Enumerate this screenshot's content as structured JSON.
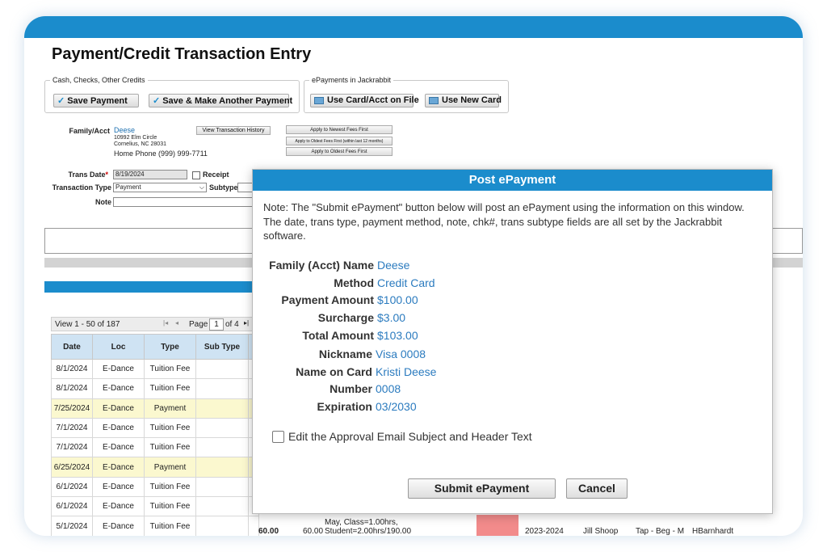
{
  "page_title": "Payment/Credit Transaction Entry",
  "groups": {
    "cash_legend": "Cash, Checks, Other Credits",
    "epay_legend": "ePayments in Jackrabbit",
    "save_payment": "Save Payment",
    "save_another": "Save & Make Another Payment",
    "use_card_on_file": "Use Card/Acct on File",
    "use_new_card": "Use New Card"
  },
  "family": {
    "label": "Family/Acct",
    "name": "Deese",
    "address1": "10992 Elm Circle",
    "address2": "Cornelius, NC 28031",
    "phone": "Home Phone (999) 999-7711",
    "view_history": "View Transaction History",
    "apply_newest": "Apply to Newest Fees First",
    "apply_oldest_12": "Apply to Oldest Fees First (within last 12 months)",
    "apply_oldest": "Apply to Oldest Fees First"
  },
  "form": {
    "trans_date_label": "Trans Date",
    "required_mark": "*",
    "trans_date": "8/19/2024",
    "receipt_label": "Receipt",
    "trans_type_label": "Transaction Type",
    "trans_type": "Payment",
    "subtype_label": "Subtype",
    "note_label": "Note"
  },
  "pager": {
    "view_text": "View 1 - 50 of 187",
    "page_label": "Page",
    "page_value": "1",
    "of_text": "of 4"
  },
  "table": {
    "headers": [
      "Date",
      "Loc",
      "Type",
      "Sub Type"
    ],
    "rows": [
      {
        "date": "8/1/2024",
        "loc": "E-Dance",
        "type": "Tuition Fee",
        "sub": "",
        "payment": false
      },
      {
        "date": "8/1/2024",
        "loc": "E-Dance",
        "type": "Tuition Fee",
        "sub": "",
        "payment": false
      },
      {
        "date": "7/25/2024",
        "loc": "E-Dance",
        "type": "Payment",
        "sub": "",
        "payment": true
      },
      {
        "date": "7/1/2024",
        "loc": "E-Dance",
        "type": "Tuition Fee",
        "sub": "",
        "payment": false
      },
      {
        "date": "7/1/2024",
        "loc": "E-Dance",
        "type": "Tuition Fee",
        "sub": "",
        "payment": false
      },
      {
        "date": "6/25/2024",
        "loc": "E-Dance",
        "type": "Payment",
        "sub": "",
        "payment": true
      },
      {
        "date": "6/1/2024",
        "loc": "E-Dance",
        "type": "Tuition Fee",
        "sub": "",
        "payment": false
      },
      {
        "date": "6/1/2024",
        "loc": "E-Dance",
        "type": "Tuition Fee",
        "sub": "",
        "payment": false
      },
      {
        "date": "5/1/2024",
        "loc": "E-Dance",
        "type": "Tuition Fee",
        "sub": "",
        "payment": false
      }
    ],
    "last_row_extra": {
      "amount1": "60.00",
      "amount2": "60.00",
      "desc_line1": "May, Class=1.00hrs,",
      "desc_line2": "Student=2.00hrs/190.00",
      "season": "2023-2024",
      "instructor": "Jill Shoop",
      "class": "Tap - Beg - M",
      "user": "HBarnhardt"
    }
  },
  "modal": {
    "title": "Post ePayment",
    "note": "Note: The \"Submit ePayment\" button below will post an ePayment using the information on this window. The date, trans type, payment method, note, chk#, trans subtype fields are all set by the Jackrabbit software.",
    "fields": {
      "family_label": "Family (Acct) Name",
      "family_value": "Deese",
      "method_label": "Method",
      "method_value": "Credit Card",
      "amount_label": "Payment Amount",
      "amount_value": "$100.00",
      "surcharge_label": "Surcharge",
      "surcharge_value": "$3.00",
      "total_label": "Total Amount",
      "total_value": "$103.00",
      "nickname_label": "Nickname",
      "nickname_value": "Visa 0008",
      "nameoncard_label": "Name on Card",
      "nameoncard_value": "Kristi Deese",
      "number_label": "Number",
      "number_value": "0008",
      "expiration_label": "Expiration",
      "expiration_value": "03/2030"
    },
    "edit_email_label": "Edit the Approval Email Subject and Header Text",
    "submit_label": "Submit ePayment",
    "cancel_label": "Cancel"
  },
  "colors": {
    "accent": "#1b8ccc",
    "link": "#2b7bbf",
    "payment_row": "#fbf8cf",
    "pink_cell": "#f28b8b"
  }
}
